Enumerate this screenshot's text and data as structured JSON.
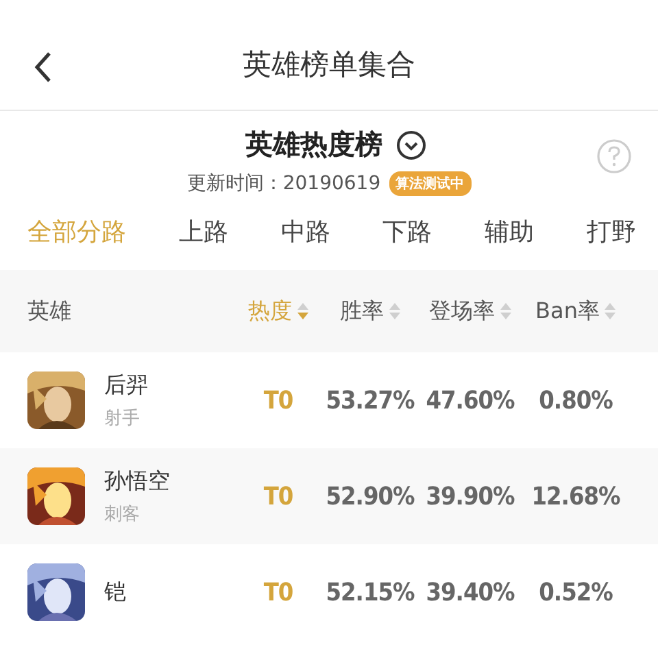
{
  "header": {
    "title": "英雄榜单集合"
  },
  "board": {
    "title": "英雄热度榜",
    "update_label": "更新时间：20190619",
    "badge": "算法测试中"
  },
  "tabs": [
    {
      "label": "全部分路",
      "selected": true
    },
    {
      "label": "上路",
      "selected": false
    },
    {
      "label": "中路",
      "selected": false
    },
    {
      "label": "下路",
      "selected": false
    },
    {
      "label": "辅助",
      "selected": false
    },
    {
      "label": "打野",
      "selected": false
    }
  ],
  "table": {
    "columns": [
      {
        "label": "英雄",
        "sorted": false,
        "sortable": false
      },
      {
        "label": "热度",
        "sorted": true,
        "sortable": true
      },
      {
        "label": "胜率",
        "sorted": false,
        "sortable": true
      },
      {
        "label": "登场率",
        "sorted": false,
        "sortable": true
      },
      {
        "label": "Ban率",
        "sorted": false,
        "sortable": true
      }
    ],
    "rows": [
      {
        "name": "后羿",
        "role": "射手",
        "tier": "T0",
        "win": "53.27%",
        "appear": "47.60%",
        "ban": "0.80%"
      },
      {
        "name": "孙悟空",
        "role": "刺客",
        "tier": "T0",
        "win": "52.90%",
        "appear": "39.90%",
        "ban": "12.68%"
      },
      {
        "name": "铠",
        "tier": "T0",
        "win": "52.15%",
        "appear": "39.40%",
        "ban": "0.52%"
      }
    ]
  }
}
